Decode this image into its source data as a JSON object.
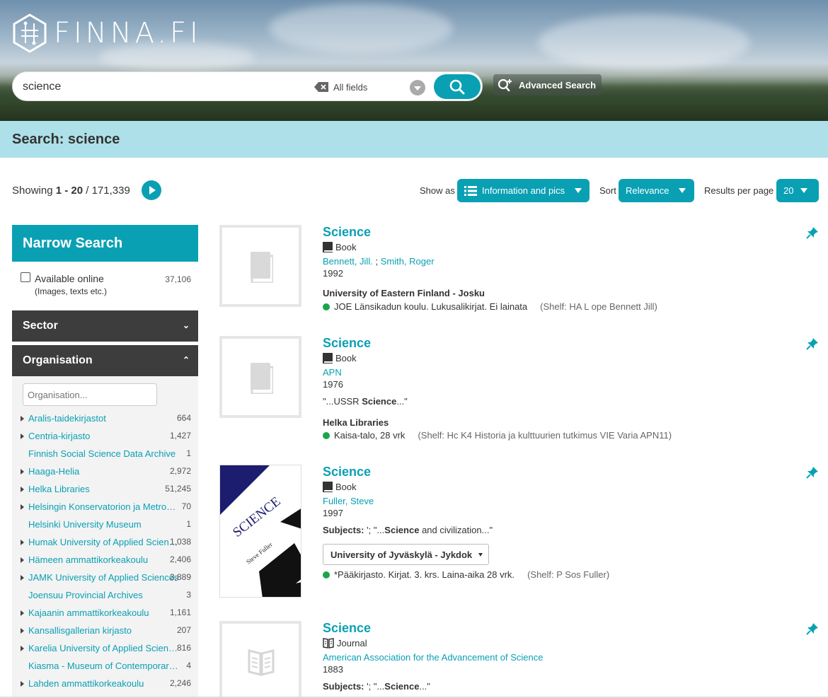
{
  "header": {
    "logo_text": "FINNA.FI",
    "search_value": "science",
    "search_field": "All fields",
    "advanced_label": "Advanced Search"
  },
  "title": "Search: science",
  "toolbar": {
    "showing_prefix": "Showing",
    "range": "1 - 20",
    "separator": "/",
    "total": "171,339",
    "show_as_label": "Show as",
    "show_as_value": "Information and pics",
    "sort_label": "Sort",
    "sort_value": "Relevance",
    "per_page_label": "Results per page",
    "per_page_value": "20"
  },
  "sidebar": {
    "narrow_title": "Narrow Search",
    "available_label": "Available online",
    "available_sub": "(Images, texts etc.)",
    "available_count": "37,106",
    "sector_label": "Sector",
    "organisation_label": "Organisation",
    "org_filter_placeholder": "Organisation...",
    "orgs": [
      {
        "name": "Aralis-taidekirjastot",
        "count": "664",
        "expandable": true
      },
      {
        "name": "Centria-kirjasto",
        "count": "1,427",
        "expandable": true
      },
      {
        "name": "Finnish Social Science Data Archive",
        "count": "1",
        "expandable": false
      },
      {
        "name": "Haaga-Helia",
        "count": "2,972",
        "expandable": true
      },
      {
        "name": "Helka Libraries",
        "count": "51,245",
        "expandable": true
      },
      {
        "name": "Helsingin Konservatorion ja Metropolia",
        "count": "70",
        "expandable": true
      },
      {
        "name": "Helsinki University Museum",
        "count": "1",
        "expandable": false
      },
      {
        "name": "Humak University of Applied Sciences",
        "count": "1,038",
        "expandable": true
      },
      {
        "name": "Hämeen ammattikorkeakoulu",
        "count": "2,406",
        "expandable": true
      },
      {
        "name": "JAMK University of Applied Sciences",
        "count": "3,889",
        "expandable": true
      },
      {
        "name": "Joensuu Provincial Archives",
        "count": "3",
        "expandable": false
      },
      {
        "name": "Kajaanin ammattikorkeakoulu",
        "count": "1,161",
        "expandable": true
      },
      {
        "name": "Kansallisgallerian kirjasto",
        "count": "207",
        "expandable": true
      },
      {
        "name": "Karelia University of Applied Sciences",
        "count": "816",
        "expandable": true
      },
      {
        "name": "Kiasma - Museum of Contemporary Art",
        "count": "4",
        "expandable": false
      },
      {
        "name": "Lahden ammattikorkeakoulu",
        "count": "2,246",
        "expandable": true
      }
    ]
  },
  "results": [
    {
      "title": "Science",
      "format": "Book",
      "author1": "Bennett, Jill.",
      "author_sep": ";",
      "author2": "Smith, Roger",
      "year": "1992",
      "org": "University of Eastern Finland - Josku",
      "location": "JOE Länsikadun koulu. Lukusalikirjat. Ei lainata",
      "shelf": "(Shelf: HA L ope Bennett Jill)"
    },
    {
      "title": "Science",
      "format": "Book",
      "author1": "APN",
      "year": "1976",
      "snippet_pre": "\"...USSR ",
      "snippet_bold": "Science",
      "snippet_post": "...\"",
      "org": "Helka Libraries",
      "location": "Kaisa-talo, 28 vrk",
      "shelf": "(Shelf: Hc K4 Historia ja kulttuurien tutkimus VIE Varia APN11)"
    },
    {
      "title": "Science",
      "format": "Book",
      "author1": "Fuller, Steve",
      "year": "1997",
      "subjects_label": "Subjects:",
      "snippet_pre": " '; \"...",
      "snippet_bold": "Science",
      "snippet_post": " and civilization...\"",
      "org_select": "University of Jyväskylä - Jykdok",
      "location": "*Pääkirjasto. Kirjat. 3. krs. Laina-aika 28 vrk.",
      "shelf": "(Shelf: P Sos Fuller)",
      "cover_title": "SCIENCE",
      "cover_author": "Steve Fuller"
    },
    {
      "title": "Science",
      "format": "Journal",
      "author1": "American Association for the Advancement of Science",
      "year": "1883",
      "subjects_label": "Subjects:",
      "snippet_pre": " '; \"...",
      "snippet_bold": "Science",
      "snippet_post": "...\""
    }
  ],
  "colors": {
    "accent": "#0aa0b4",
    "title_bar": "#ade0e8",
    "facet_dark": "#3d3d3d",
    "available": "#1aa54b"
  }
}
